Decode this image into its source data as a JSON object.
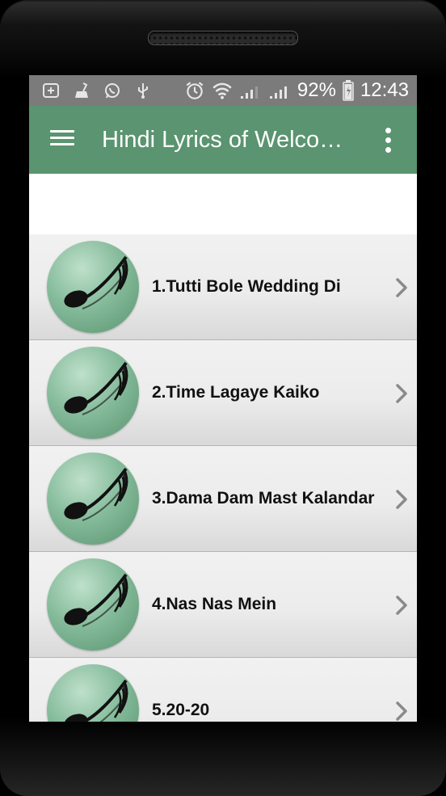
{
  "status_bar": {
    "left_icons": [
      "add-icon",
      "cleaner-icon",
      "whatsapp-icon",
      "usb-icon"
    ],
    "right_icons": [
      "alarm-icon",
      "wifi-icon",
      "signal-1-icon",
      "signal-2-icon",
      "battery-icon"
    ],
    "battery_percent": "92%",
    "time": "12:43"
  },
  "app_bar": {
    "title": "Hindi Lyrics of Welco…",
    "background": "#5a9470"
  },
  "songs": [
    {
      "label": "1.Tutti Bole Wedding Di"
    },
    {
      "label": "2.Time Lagaye Kaiko"
    },
    {
      "label": "3.Dama Dam Mast Kalandar"
    },
    {
      "label": "4.Nas Nas Mein"
    },
    {
      "label": "5.20-20"
    }
  ]
}
